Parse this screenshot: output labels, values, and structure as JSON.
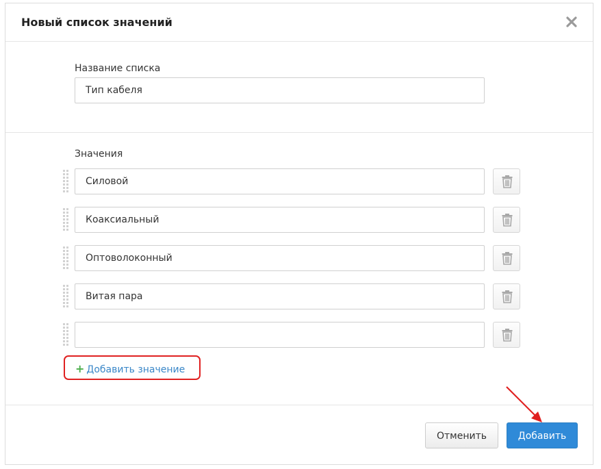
{
  "dialog": {
    "title": "Новый список значений"
  },
  "list_name": {
    "label": "Название списка",
    "value": "Тип кабеля"
  },
  "values": {
    "label": "Значения",
    "items": [
      {
        "value": "Силовой"
      },
      {
        "value": "Коаксиальный"
      },
      {
        "value": "Оптоволоконный"
      },
      {
        "value": "Витая пара"
      },
      {
        "value": ""
      }
    ],
    "add_label": "Добавить значение"
  },
  "footer": {
    "cancel_label": "Отменить",
    "add_label": "Добавить"
  },
  "colors": {
    "accent": "#2f8ad8",
    "link": "#3a87c8",
    "plus": "#4cae4c",
    "highlight": "#e02020"
  },
  "icons": [
    "close-icon",
    "drag-handle-icon",
    "trash-icon",
    "plus-icon",
    "annotation-arrow-icon"
  ]
}
